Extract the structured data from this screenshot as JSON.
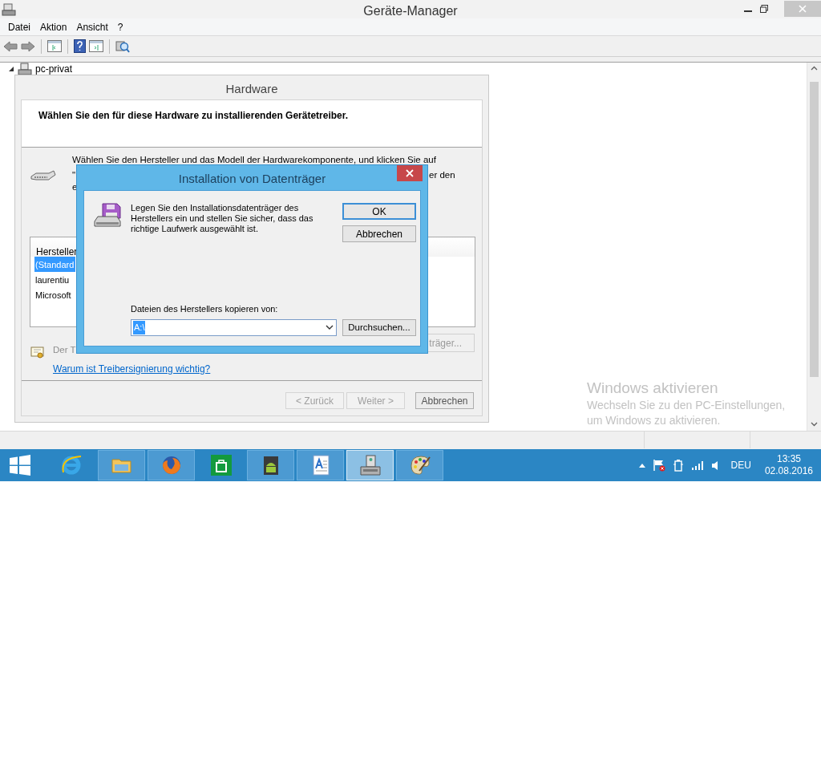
{
  "window": {
    "title": "Geräte-Manager"
  },
  "menu": [
    "Datei",
    "Aktion",
    "Ansicht",
    "?"
  ],
  "tree": [
    {
      "label": "pc-privat",
      "expanded": true
    }
  ],
  "wizard": {
    "title": "Hardware",
    "header": "Wählen Sie den für diese Hardware zu installierenden Gerätetreiber.",
    "intro_fragments": [
      "Wählen Sie den Hersteller und das Modell der Hardwarekomponente, und klicken Sie auf",
      "\"",
      "er den",
      "e"
    ],
    "list_header": "Hersteller",
    "list_items": [
      {
        "label": "(Standard",
        "selected": true
      },
      {
        "label": "laurentiu",
        "selected": false
      },
      {
        "label": "Microsoft",
        "selected": false
      }
    ],
    "signing_text": "Der T",
    "side_button": "träger...",
    "link": "Warum ist Treibersignierung wichtig?",
    "buttons": [
      {
        "label": "< Zurück",
        "disabled": true
      },
      {
        "label": "Weiter >",
        "disabled": true
      },
      {
        "label": "Abbrechen",
        "disabled": false
      }
    ]
  },
  "dialog": {
    "title": "Installation von Datenträger",
    "message": "Legen Sie den Installationsdatenträger des Herstellers ein und stellen Sie sicher, dass das richtige Laufwerk ausgewählt ist.",
    "buttons": [
      {
        "label": "OK",
        "default": true
      },
      {
        "label": "Abbrechen",
        "default": false
      }
    ],
    "source_label": "Dateien des Herstellers kopieren von:",
    "source_value": "A:\\",
    "source_selected": true,
    "browse_button": "Durchsuchen..."
  },
  "activation": {
    "title": "Windows aktivieren",
    "body": "Wechseln Sie zu den PC-Einstellungen, um Windows zu aktivieren."
  },
  "taskbar": {
    "apps": [
      {
        "kind": "ie",
        "active": false
      },
      {
        "kind": "explorer",
        "active": false
      },
      {
        "kind": "firefox",
        "active": false
      },
      {
        "kind": "store",
        "active": false
      },
      {
        "kind": "android",
        "active": false
      },
      {
        "kind": "wordpad",
        "active": false
      },
      {
        "kind": "devmgr",
        "active": true
      },
      {
        "kind": "paint",
        "active": false
      }
    ],
    "language": "DEU",
    "time": "13:35",
    "date": "02.08.2016"
  }
}
